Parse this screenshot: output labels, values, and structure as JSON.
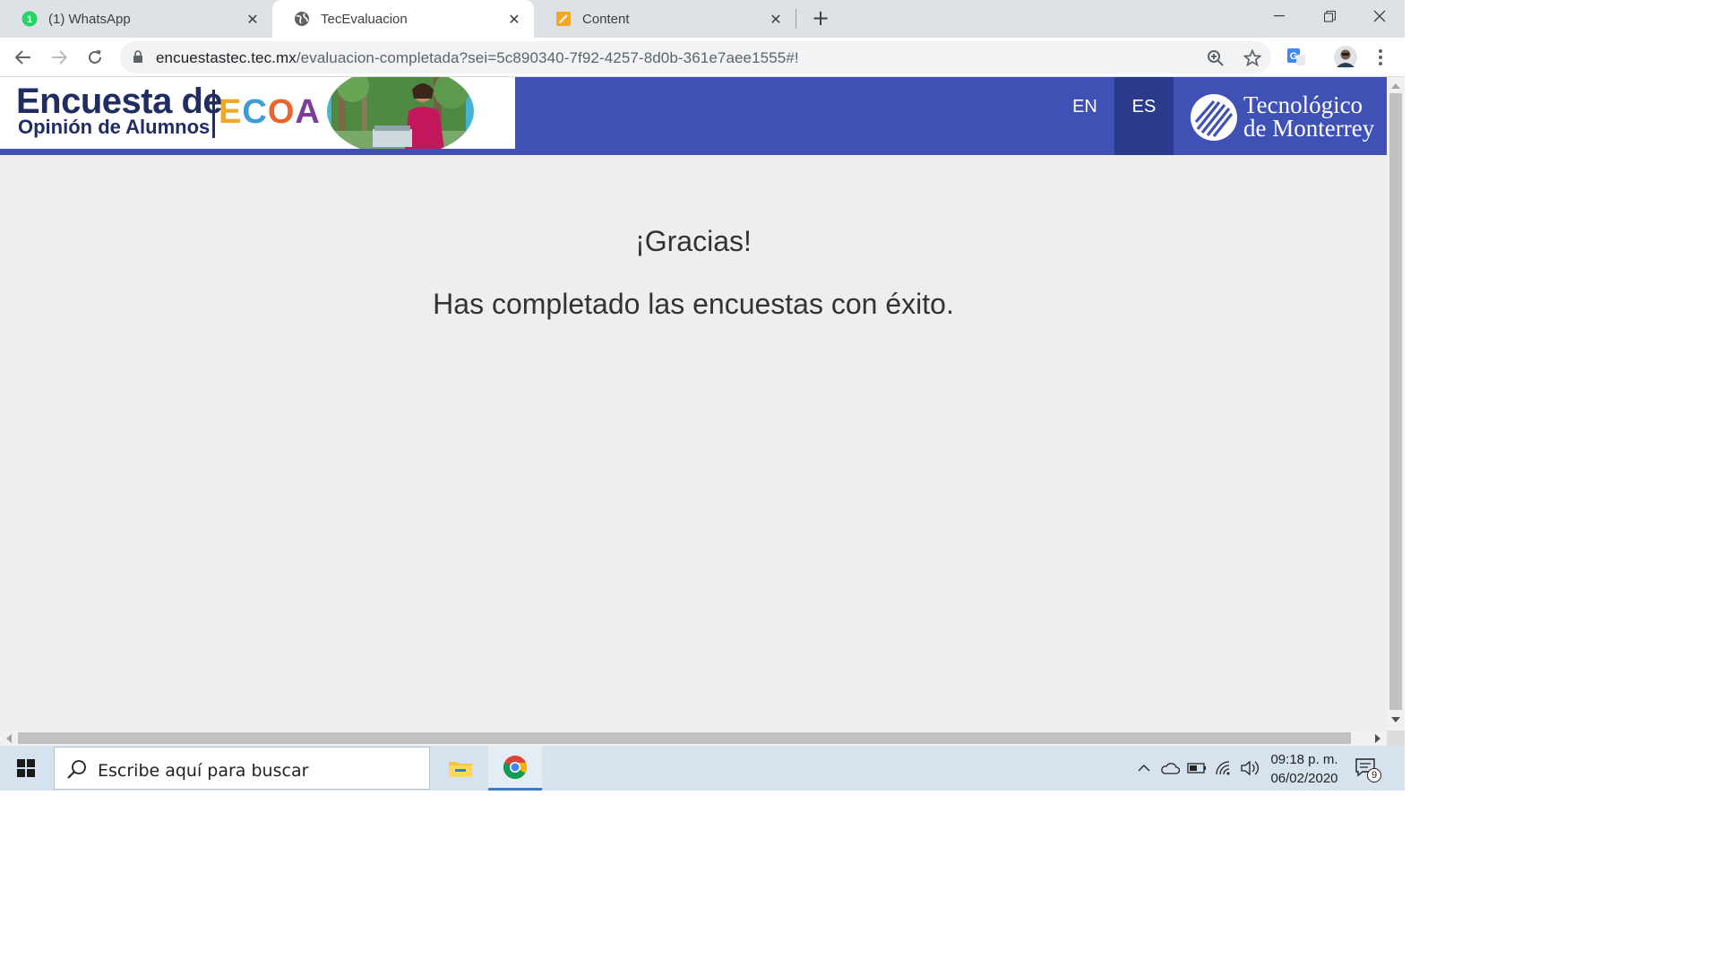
{
  "browser": {
    "tabs": [
      {
        "title": "(1) WhatsApp",
        "badge": "1"
      },
      {
        "title": "TecEvaluacion"
      },
      {
        "title": "Content"
      }
    ],
    "url_host": "encuestastec.tec.mx",
    "url_path": "/evaluacion-completada?sei=5c890340-7f92-4257-8d0b-361e7aee1555#!"
  },
  "header": {
    "brand_line1": "Encuesta de",
    "brand_line2": "Opinión de Alumnos",
    "brand_acronym": [
      "E",
      "C",
      "O",
      "A"
    ],
    "brand_acronym_colors": [
      "#f5a623",
      "#3f9bd6",
      "#e9652b",
      "#7d3c98"
    ],
    "languages": [
      "EN",
      "ES"
    ],
    "selected_language": "ES",
    "institution_line1": "Tecnológico",
    "institution_line2": "de Monterrey"
  },
  "main": {
    "heading": "¡Gracias!",
    "message": "Has completado las encuestas con éxito."
  },
  "taskbar": {
    "search_placeholder": "Escribe aquí para buscar",
    "time": "09:18 p. m.",
    "date": "06/02/2020",
    "notification_count": "9"
  },
  "colors": {
    "header_blue": "#3f51b5",
    "selected_lang_bg": "#2c3a8c",
    "content_bg": "#eeeeee"
  }
}
